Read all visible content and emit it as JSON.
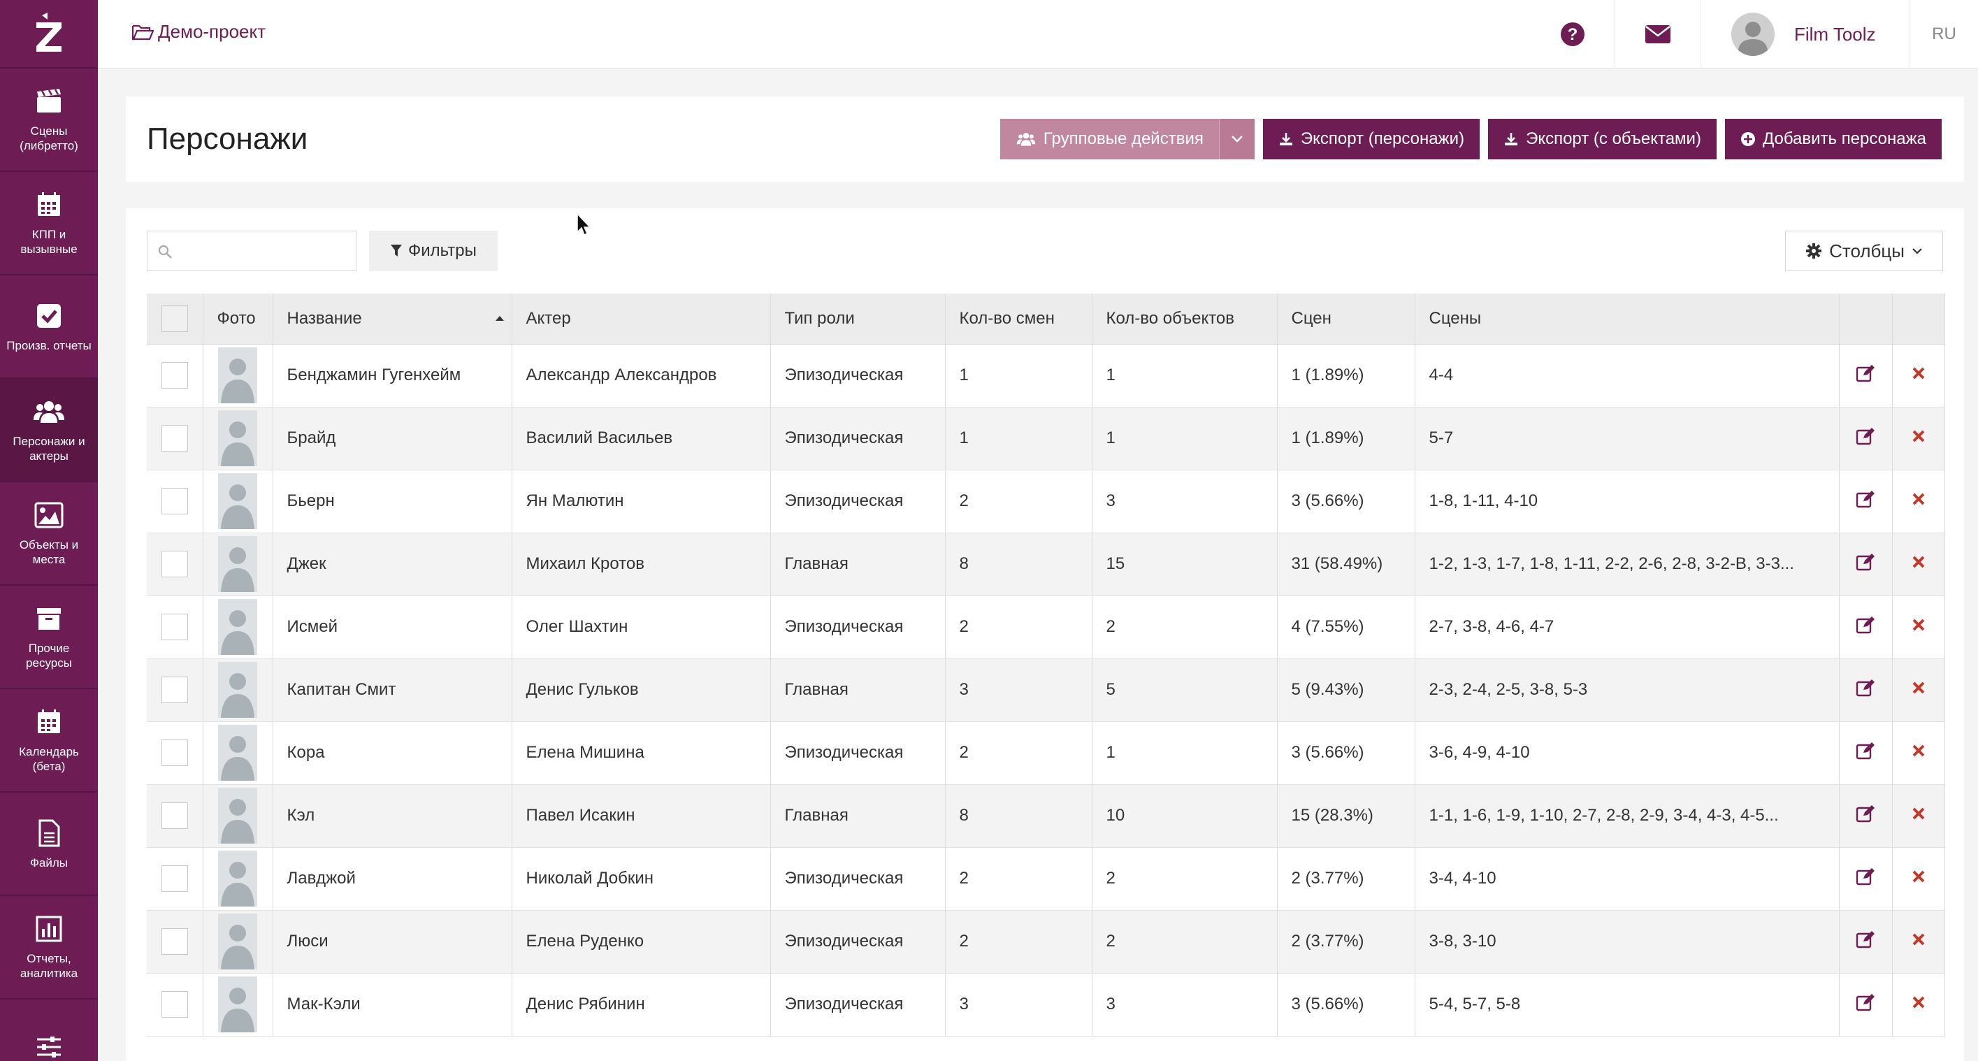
{
  "sidebar": {
    "items": [
      {
        "label": "Сцены\n(либретто)",
        "icon": "clapperboard-icon"
      },
      {
        "label": "КПП и\nвызывные",
        "icon": "calendar-icon"
      },
      {
        "label": "Произв. отчеты",
        "icon": "checkbox-icon"
      },
      {
        "label": "Персонажи и\nактеры",
        "icon": "users-icon"
      },
      {
        "label": "Объекты и\nместа",
        "icon": "image-icon"
      },
      {
        "label": "Прочие\nресурсы",
        "icon": "archive-icon"
      },
      {
        "label": "Календарь\n(бета)",
        "icon": "calendar-icon"
      },
      {
        "label": "Файлы",
        "icon": "file-icon"
      },
      {
        "label": "Отчеты,\nаналитика",
        "icon": "bar-chart-icon"
      }
    ]
  },
  "topbar": {
    "project": "Демо-проект",
    "user_name": "Film Toolz",
    "lang": "RU"
  },
  "header": {
    "title": "Персонажи",
    "group_actions": "Групповые действия",
    "export_characters": "Экспорт (персонажи)",
    "export_objects": "Экспорт (с объектами)",
    "add_character": "Добавить персонажа"
  },
  "toolbar": {
    "search_value": "",
    "filters": "Фильтры",
    "columns": "Столбцы"
  },
  "table": {
    "headers": {
      "photo": "Фото",
      "name": "Название",
      "actor": "Актер",
      "role": "Тип роли",
      "shifts": "Кол-во смен",
      "objects": "Кол-во объектов",
      "scenes_count": "Сцен",
      "scenes": "Сцены"
    },
    "rows": [
      {
        "name": "Бенджамин Гугенхейм",
        "actor": "Александр Александров",
        "role": "Эпизодическая",
        "shifts": "1",
        "objects": "1",
        "scenes_count": "1 (1.89%)",
        "scenes": "4-4"
      },
      {
        "name": "Брайд",
        "actor": "Василий Васильев",
        "role": "Эпизодическая",
        "shifts": "1",
        "objects": "1",
        "scenes_count": "1 (1.89%)",
        "scenes": "5-7"
      },
      {
        "name": "Бьерн",
        "actor": "Ян Малютин",
        "role": "Эпизодическая",
        "shifts": "2",
        "objects": "3",
        "scenes_count": "3 (5.66%)",
        "scenes": "1-8, 1-11, 4-10"
      },
      {
        "name": "Джек",
        "actor": "Михаил Кротов",
        "role": "Главная",
        "shifts": "8",
        "objects": "15",
        "scenes_count": "31 (58.49%)",
        "scenes": "1-2, 1-3, 1-7, 1-8, 1-11, 2-2, 2-6, 2-8, 3-2-В, 3-3..."
      },
      {
        "name": "Исмей",
        "actor": "Олег Шахтин",
        "role": "Эпизодическая",
        "shifts": "2",
        "objects": "2",
        "scenes_count": "4 (7.55%)",
        "scenes": "2-7, 3-8, 4-6, 4-7"
      },
      {
        "name": "Капитан Смит",
        "actor": "Денис Гульков",
        "role": "Главная",
        "shifts": "3",
        "objects": "5",
        "scenes_count": "5 (9.43%)",
        "scenes": "2-3, 2-4, 2-5, 3-8, 5-3"
      },
      {
        "name": "Кора",
        "actor": "Елена Мишина",
        "role": "Эпизодическая",
        "shifts": "2",
        "objects": "1",
        "scenes_count": "3 (5.66%)",
        "scenes": "3-6, 4-9, 4-10"
      },
      {
        "name": "Кэл",
        "actor": "Павел Исакин",
        "role": "Главная",
        "shifts": "8",
        "objects": "10",
        "scenes_count": "15 (28.3%)",
        "scenes": "1-1, 1-6, 1-9, 1-10, 2-7, 2-8, 2-9, 3-4, 4-3, 4-5..."
      },
      {
        "name": "Лавджой",
        "actor": "Николай Добкин",
        "role": "Эпизодическая",
        "shifts": "2",
        "objects": "2",
        "scenes_count": "2 (3.77%)",
        "scenes": "3-4, 4-10"
      },
      {
        "name": "Люси",
        "actor": "Елена Руденко",
        "role": "Эпизодическая",
        "shifts": "2",
        "objects": "2",
        "scenes_count": "2 (3.77%)",
        "scenes": "3-8, 3-10"
      },
      {
        "name": "Мак-Кэли",
        "actor": "Денис Рябинин",
        "role": "Эпизодическая",
        "shifts": "3",
        "objects": "3",
        "scenes_count": "3 (5.66%)",
        "scenes": "5-4, 5-7, 5-8"
      }
    ]
  },
  "colors": {
    "brand": "#6d1d53",
    "delete": "#c0392b"
  }
}
